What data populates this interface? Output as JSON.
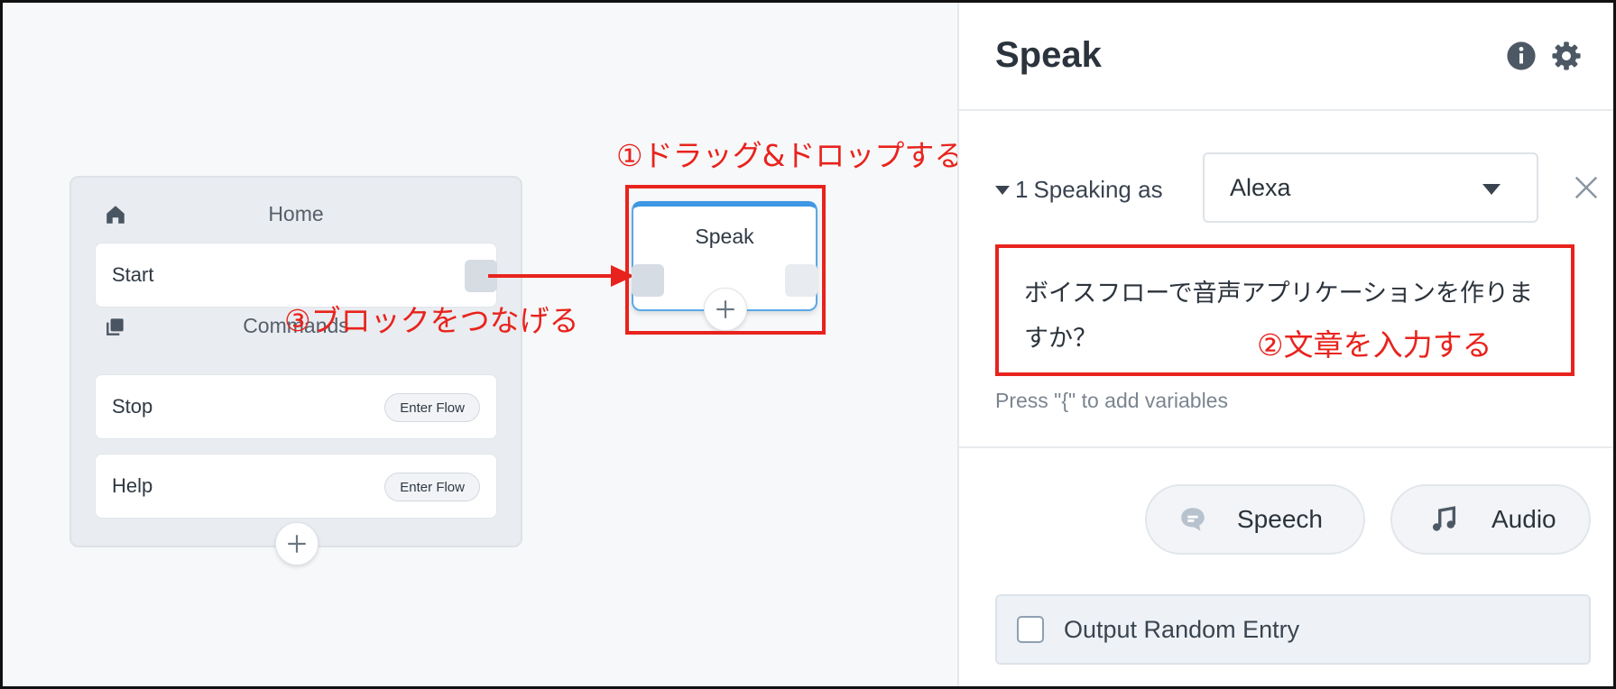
{
  "canvas": {
    "home_block": {
      "title": "Home",
      "start_label": "Start",
      "commands_title": "Commands",
      "commands": [
        {
          "label": "Stop",
          "button": "Enter Flow"
        },
        {
          "label": "Help",
          "button": "Enter Flow"
        }
      ]
    },
    "speak_block": {
      "title": "Speak"
    },
    "annotations": {
      "drag_drop": "①ドラッグ&ドロップする",
      "connect": "③ブロックをつなげる",
      "enter_text": "②文章を入力する"
    }
  },
  "panel": {
    "title": "Speak",
    "speaking_index": "1",
    "speaking_label": "Speaking as",
    "voice": "Alexa",
    "speech_text": "ボイスフローで音声アプリケーションを作りますか？",
    "hint": "Press \"{\" to add variables",
    "speech_button": "Speech",
    "audio_button": "Audio",
    "random_entry_label": "Output Random Entry"
  },
  "colors": {
    "accent_blue": "#3d97e3",
    "annotation_red": "#e8231d"
  },
  "icons": [
    "home-icon",
    "commands-icon",
    "plus-icon",
    "info-icon",
    "gear-icon",
    "caret-down-icon",
    "close-icon",
    "speech-bubble-icon",
    "music-note-icon"
  ]
}
